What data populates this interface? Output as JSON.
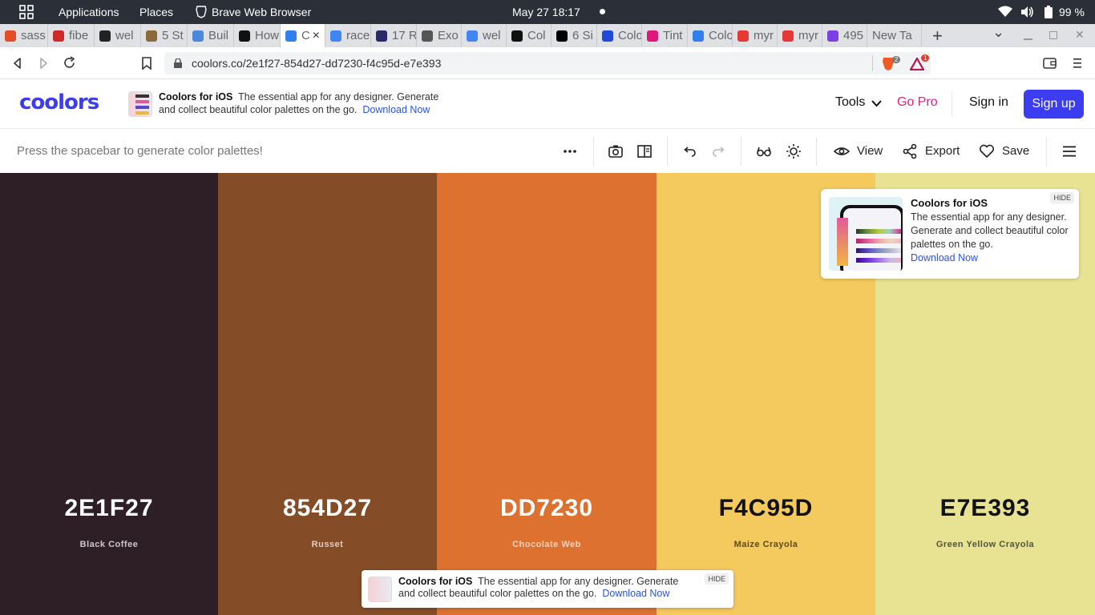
{
  "system_bar": {
    "apps_label": "Applications",
    "places_label": "Places",
    "browser_label": "Brave Web Browser",
    "clock": "May 27  18:17",
    "battery": "99 %"
  },
  "tabs": [
    {
      "label": "sass",
      "color": "#e44d26"
    },
    {
      "label": "fibe",
      "color": "#cc2a2a"
    },
    {
      "label": "wel",
      "color": "#222222"
    },
    {
      "label": "5 St",
      "color": "#8a6a3a"
    },
    {
      "label": "Buil",
      "color": "#4a8ad8"
    },
    {
      "label": "How",
      "color": "#111111"
    },
    {
      "label": "C",
      "color": "#2f80ed",
      "active": true
    },
    {
      "label": "race",
      "color": "#4285f4"
    },
    {
      "label": "17 R",
      "color": "#2a2a6a"
    },
    {
      "label": "Exo",
      "color": "#555555"
    },
    {
      "label": "wel",
      "color": "#4285f4"
    },
    {
      "label": "Col",
      "color": "#111111"
    },
    {
      "label": "6 Si",
      "color": "#000000"
    },
    {
      "label": "Colo",
      "color": "#1e4bd8"
    },
    {
      "label": "Tint",
      "color": "#e0177a"
    },
    {
      "label": "Colo",
      "color": "#2f80ed"
    },
    {
      "label": "myr",
      "color": "#e53935"
    },
    {
      "label": "myr",
      "color": "#e53935"
    },
    {
      "label": "495",
      "color": "#7b3fe4"
    },
    {
      "label": "New Ta",
      "color": "#dfe1e5"
    }
  ],
  "address_bar": {
    "url": "coolors.co/2e1f27-854d27-dd7230-f4c95d-e7e393",
    "shield_count": "2",
    "rewards_count": "1"
  },
  "header": {
    "logo": "coolors",
    "promo_title": "Coolors for iOS",
    "promo_text": "The essential app for any designer. Generate and collect beautiful color palettes on the go.",
    "promo_link": "Download Now",
    "tools_label": "Tools",
    "gopro_label": "Go Pro",
    "signin_label": "Sign in",
    "signup_label": "Sign up"
  },
  "toolbar": {
    "hint": "Press the spacebar to generate color palettes!",
    "view_label": "View",
    "export_label": "Export",
    "save_label": "Save"
  },
  "palette": [
    {
      "hex": "2E1F27",
      "name": "Black Coffee",
      "color": "#2e1f27",
      "text_color": "#ffffff",
      "name_color": "#cfc6cb"
    },
    {
      "hex": "854D27",
      "name": "Russet",
      "color": "#854d27",
      "text_color": "#ffffff",
      "name_color": "#e3cdbd"
    },
    {
      "hex": "DD7230",
      "name": "Chocolate Web",
      "color": "#dd7230",
      "text_color": "#ffffff",
      "name_color": "#f6d3bc"
    },
    {
      "hex": "F4C95D",
      "name": "Maize Crayola",
      "color": "#f4c95d",
      "text_color": "#111111",
      "name_color": "#5b4a20"
    },
    {
      "hex": "E7E393",
      "name": "Green Yellow Crayola",
      "color": "#e7e393",
      "text_color": "#111111",
      "name_color": "#55543a"
    }
  ],
  "ios_card": {
    "title": "Coolors for iOS",
    "body": "The essential app for any designer. Generate and collect beautiful color palettes on the go.",
    "link": "Download Now",
    "hide_label": "HIDE"
  },
  "bottom_promo": {
    "title": "Coolors for iOS",
    "body": "The essential app for any designer. Generate and collect beautiful color palettes on the go.",
    "link": "Download Now",
    "hide_label": "HIDE"
  },
  "colors": {
    "accent": "#3c3cf0",
    "pro": "#e01e8a",
    "link": "#2a53e4"
  }
}
